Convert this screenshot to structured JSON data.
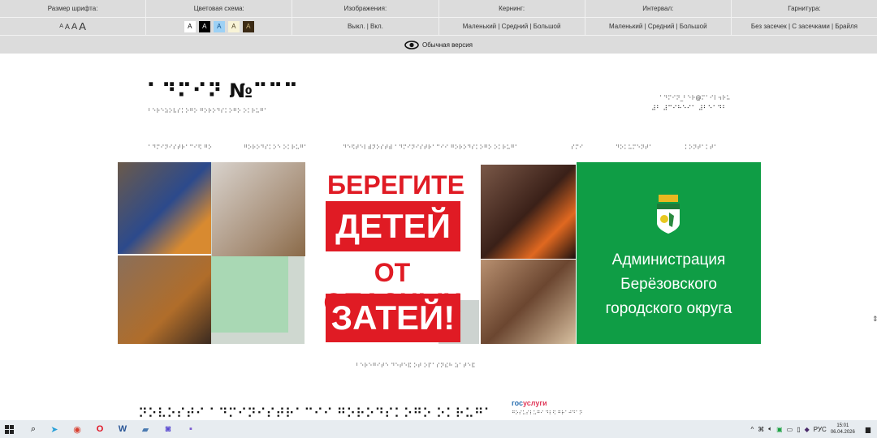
{
  "a11y_panel": {
    "font_size": {
      "label": "Размер шрифта:",
      "options": [
        "A",
        "A",
        "A",
        "A"
      ]
    },
    "color_scheme": {
      "label": "Цветовая схема:",
      "options": [
        "A",
        "A",
        "A",
        "A",
        "A"
      ]
    },
    "images": {
      "label": "Изображения:",
      "value": "Выкл. | Вкл."
    },
    "kerning": {
      "label": "Кернинг:",
      "value": "Маленький | Средний | Большой"
    },
    "interval": {
      "label": "Интервал:",
      "value": "Маленький | Средний | Большой"
    },
    "typeface": {
      "label": "Гарнитура:",
      "value": "Без засечек | С засечками | Брайля"
    },
    "normal_version": "Обычная версия"
  },
  "header": {
    "title_braille": "⠁⠙⠍⠊⠝ №⠉⠉⠉",
    "subtitle_braille": "⠃⠑⠗⠑⠵⠕⠧⠎⠅⠕⠛⠕ ⠛⠕⠗⠕⠙⠎⠅⠕⠛⠕ ⠕⠅⠗⠥⠛⠁",
    "contact_email_braille": "⠁⠙⠍⠊⠝_⠃⠑⠗@⠍⠁⠊⠇⠲⠗⠥",
    "contact_phone_braille": "⠼⠃ ⠼⠉⠊⠓⠑⠊⠁ ⠼⠃⠑⠁⠙⠃"
  },
  "nav": [
    "⠁⠙⠍⠊⠝⠊⠎⠞⠗⠁⠉⠊⠫ ⠛⠕",
    "⠛⠕⠗⠕⠙⠎⠅⠕⠑ ⠕⠅⠗⠥⠛⠁",
    "⠙⠑⠫⠞⠑⠇⠾⠝⠕⠎⠞⠾ ⠁⠙⠍⠊⠝⠊⠎⠞⠗⠁⠉⠊⠊ ⠛⠕⠗⠕⠙⠎⠅⠕⠛⠕ ⠕⠅⠗⠥⠛⠁",
    "⠎⠍⠊",
    "⠙⠕⠅⠥⠍⠑⠝⠞⠁",
    "⠅⠕⠝⠞⠁⠅⠞⠁"
  ],
  "banner": {
    "line1": "БЕРЕГИТЕ",
    "line2": "ДЕТЕЙ",
    "line3": "ОТ ОПАСНЫХ",
    "line4": "ЗАТЕЙ!",
    "org_line1": "Администрация",
    "org_line2": "Берёзовского",
    "org_line3": "городского округа",
    "caption_braille": "⠃⠑⠗⠑⠛⠊⠞⠑ ⠙⠑⠞⠑⠯ ⠕⠞ ⠕⠏⠁⠎⠝⠮⠓ ⠵⠁⠞⠑⠯"
  },
  "bottom": {
    "heading_braille": "⠝⠕⠧⠕⠎⠞⠊ ⠁⠙⠍⠊⠝⠊⠎⠞⠗⠁⠉⠊⠊ ⠛⠕⠗⠕⠙⠎⠅⠕⠛⠕ ⠕⠅⠗⠥⠛⠁",
    "gosuslugi_prefix": "гос",
    "gosuslugi_suffix": "услуги",
    "gosuslugi_braille": "⠛⠕⠎⠥⠎⠇⠥⠛⠊ ⠙⠇⠫ ⠛⠗⠁⠚⠙⠁⠝"
  },
  "taskbar": {
    "lang": "РУС",
    "time": "15:01",
    "date": "06.04.2026"
  }
}
